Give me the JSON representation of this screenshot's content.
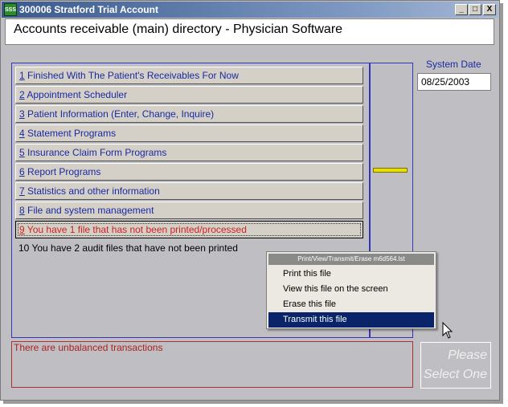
{
  "window": {
    "title": "300006 Stratford Trial Account",
    "icon_text": "SSS",
    "controls": {
      "minimize": "_",
      "maximize": "□",
      "close": "X"
    }
  },
  "header": {
    "title": "Accounts receivable (main) directory - Physician Software"
  },
  "system_date": {
    "label": "System Date",
    "value": "08/25/2003"
  },
  "menu": [
    {
      "num": "1",
      "label": " Finished With The Patient's Receivables For Now"
    },
    {
      "num": "2",
      "label": " Appointment Scheduler"
    },
    {
      "num": "3",
      "label": " Patient Information (Enter, Change, Inquire)"
    },
    {
      "num": "4",
      "label": " Statement Programs"
    },
    {
      "num": "5",
      "label": " Insurance Claim Form Programs"
    },
    {
      "num": "6",
      "label": " Report Programs"
    },
    {
      "num": "7",
      "label": " Statistics and other information"
    },
    {
      "num": "8",
      "label": " File and system management"
    },
    {
      "num": "9",
      "label": " You have 1 file that has not been printed/processed"
    },
    {
      "num": "10",
      "label": " You have 2 audit files that have not been printed"
    }
  ],
  "status": {
    "message": "There are unbalanced transactions"
  },
  "action": {
    "line1": "Please",
    "line2": "Select One"
  },
  "context_menu": {
    "title": "Print/View/Transmit/Erase m6d564.lst",
    "items": [
      {
        "label": "Print this file"
      },
      {
        "label": "View this file on the screen"
      },
      {
        "label": "Erase this file"
      },
      {
        "label": "Transmit this file"
      }
    ],
    "selected_index": 3
  },
  "colors": {
    "title_bar": "#3a5a8c",
    "menu_text": "#1a2aa0",
    "alert_text": "#d02020",
    "selection": "#0a246a",
    "indicator": "#e8e000"
  }
}
